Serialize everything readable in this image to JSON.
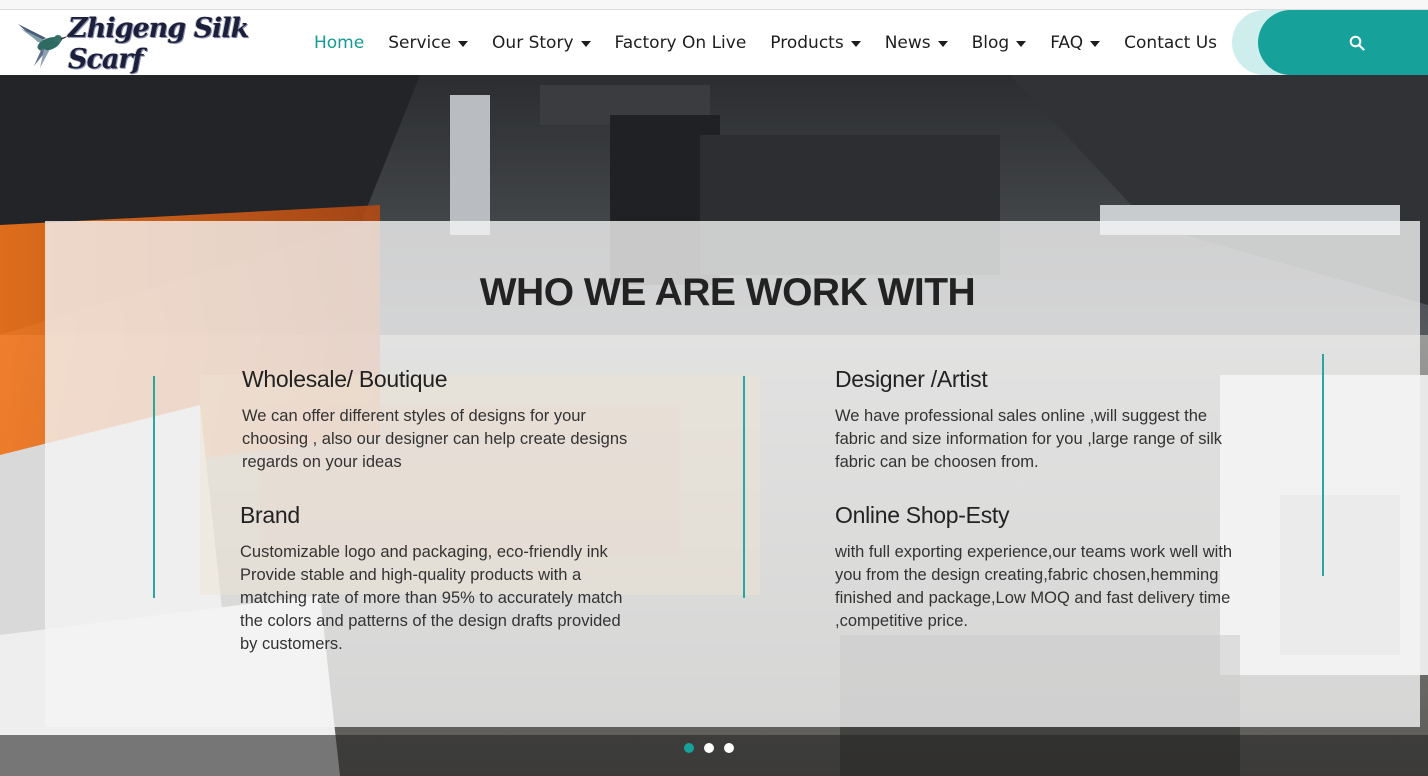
{
  "brand": {
    "logo_text": "Zhigeng Silk Scarf",
    "logo_icon": "hummingbird-icon"
  },
  "nav": {
    "items": [
      {
        "label": "Home",
        "active": true,
        "has_dropdown": false
      },
      {
        "label": "Service",
        "active": false,
        "has_dropdown": true
      },
      {
        "label": "Our Story",
        "active": false,
        "has_dropdown": true
      },
      {
        "label": "Factory On Live",
        "active": false,
        "has_dropdown": false
      },
      {
        "label": "Products",
        "active": false,
        "has_dropdown": true
      },
      {
        "label": "News",
        "active": false,
        "has_dropdown": true
      },
      {
        "label": "Blog",
        "active": false,
        "has_dropdown": true
      },
      {
        "label": "FAQ",
        "active": false,
        "has_dropdown": true
      },
      {
        "label": "Contact Us",
        "active": false,
        "has_dropdown": false
      }
    ],
    "search_icon": "search-icon"
  },
  "hero": {
    "title": "WHO WE ARE WORK WITH",
    "blocks": [
      {
        "heading": "Wholesale/ Boutique",
        "text": "We can offer different styles of designs for your choosing , also our designer can help create designs regards on your ideas"
      },
      {
        "heading": "Designer /Artist",
        "text": "We have professional sales online ,will suggest the fabric and size information for you ,large range of silk fabric can be choosen from."
      },
      {
        "heading": "Brand",
        "text": "Customizable logo and packaging, eco-friendly ink Provide stable and high-quality products with a matching rate of more than 95% to accurately match the colors and patterns of the design drafts provided by customers."
      },
      {
        "heading": "Online Shop-Esty",
        "text": "with full exporting experience,our teams work well with you from the design creating,fabric chosen,hemming finished and package,Low MOQ and fast delivery time ,competitive price."
      }
    ],
    "slider": {
      "count": 3,
      "active_index": 0
    }
  },
  "colors": {
    "accent": "#17a19b",
    "accent_light": "#cdeeed",
    "text": "#222222",
    "panel": "#f4f4f4"
  }
}
